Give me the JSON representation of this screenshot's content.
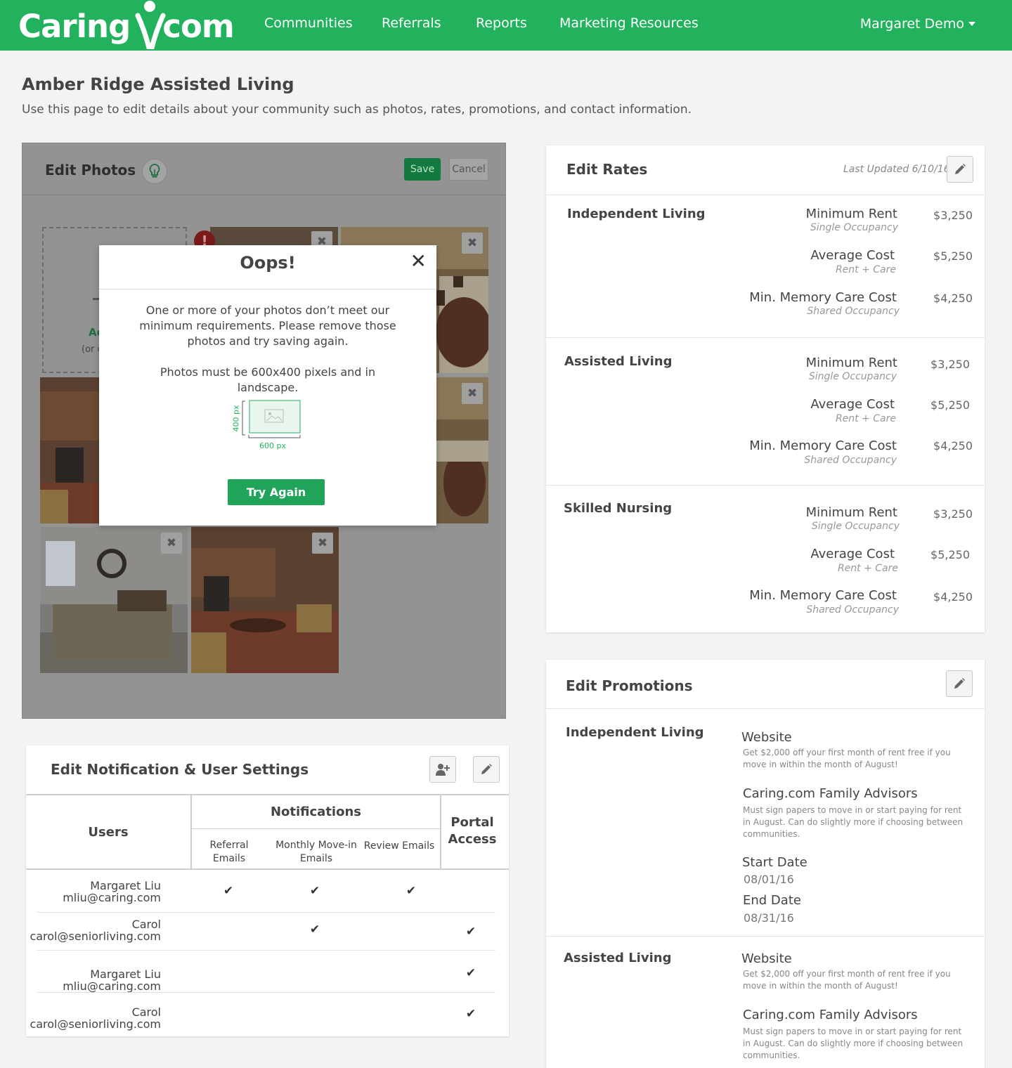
{
  "nav": {
    "logo_left": "Caring",
    "logo_right": "com",
    "links": [
      "Communities",
      "Referrals",
      "Reports",
      "Marketing Resources"
    ],
    "user": "Margaret Demo"
  },
  "page": {
    "title": "Amber Ridge Assisted Living",
    "subtitle": "Use this page to edit details about your community such as photos, rates, promotions, and contact information."
  },
  "photos": {
    "title": "Edit Photos",
    "save_label": "Save",
    "cancel_label": "Cancel",
    "add_label": "Ac",
    "add_hint": "(or c",
    "remove_glyph": "✖",
    "warning_glyph": "!"
  },
  "modal": {
    "title": "Oops!",
    "close_glyph": "✕",
    "message": "One or more of your photos don’t meet our minimum requirements. Please remove those photos and try saving again.",
    "requirement": "Photos must be 600x400 pixels and in landscape.",
    "height_label": "400 px",
    "width_label": "600 px",
    "button": "Try Again"
  },
  "rates": {
    "title": "Edit Rates",
    "last_updated": "Last Updated 6/10/16",
    "sections": [
      {
        "name": "Independent Living",
        "rows": [
          {
            "label": "Minimum Rent",
            "sub": "Single Occupancy",
            "value": "$3,250"
          },
          {
            "label": "Average Cost",
            "sub": "Rent + Care",
            "value": "$5,250"
          },
          {
            "label": "Min. Memory Care Cost",
            "sub": "Shared Occupancy",
            "value": "$4,250"
          }
        ]
      },
      {
        "name": "Assisted Living",
        "rows": [
          {
            "label": "Minimum Rent",
            "sub": "Single Occupancy",
            "value": "$3,250"
          },
          {
            "label": "Average Cost",
            "sub": "Rent + Care",
            "value": "$5,250"
          },
          {
            "label": "Min. Memory Care Cost",
            "sub": "Shared Occupancy",
            "value": "$4,250"
          }
        ]
      },
      {
        "name": "Skilled Nursing",
        "rows": [
          {
            "label": "Minimum Rent",
            "sub": "Single Occupancy",
            "value": "$3,250"
          },
          {
            "label": "Average Cost",
            "sub": "Rent + Care",
            "value": "$5,250"
          },
          {
            "label": "Min. Memory Care Cost",
            "sub": "Shared Occupancy",
            "value": "$4,250"
          }
        ]
      }
    ]
  },
  "promotions": {
    "title": "Edit Promotions",
    "sections": [
      {
        "name": "Independent Living",
        "website_label": "Website",
        "website_text": "Get $2,000 off your first month of rent free if you move in within the month of August!",
        "advisors_label": "Caring.com Family Advisors",
        "advisors_text": "Must sign papers to move in or start paying for rent in August. Can do slightly more if choosing between communities.",
        "start_label": "Start Date",
        "start_value": "08/01/16",
        "end_label": "End Date",
        "end_value": "08/31/16"
      },
      {
        "name": "Assisted Living",
        "website_label": "Website",
        "website_text": "Get $2,000 off your first month of rent free if you move in within the month of August!",
        "advisors_label": "Caring.com Family Advisors",
        "advisors_text": "Must sign papers to move in or start paying for rent in August. Can do slightly more if choosing between communities."
      }
    ]
  },
  "notifications": {
    "title": "Edit Notification & User Settings",
    "headers": {
      "users": "Users",
      "notifications": "Notifications",
      "referral": "Referral Emails",
      "movein": "Monthly Move-in Emails",
      "review": "Review Emails",
      "portal": "Portal Access"
    },
    "check_glyph": "✔",
    "rows": [
      {
        "name": "Margaret Liu",
        "email": "mliu@caring.com",
        "referral": true,
        "movein": true,
        "review": true,
        "portal": false
      },
      {
        "name": "Carol",
        "email": "carol@seniorliving.com",
        "referral": false,
        "movein": true,
        "review": false,
        "portal": true
      },
      {
        "name": "Margaret Liu",
        "email": "mliu@caring.com",
        "referral": false,
        "movein": false,
        "review": false,
        "portal": true
      },
      {
        "name": "Carol",
        "email": "carol@seniorliving.com",
        "referral": false,
        "movein": false,
        "review": false,
        "portal": true
      }
    ]
  }
}
